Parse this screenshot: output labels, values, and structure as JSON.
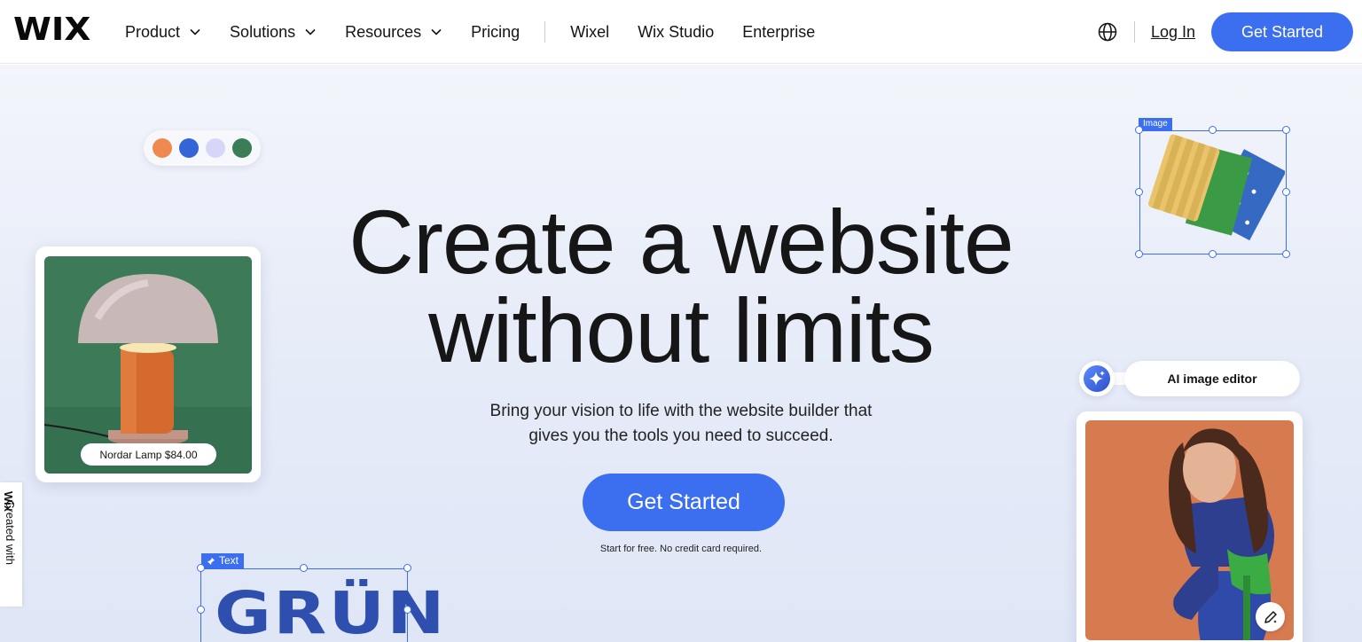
{
  "header": {
    "logo": "WIX",
    "nav": [
      {
        "label": "Product",
        "has_dropdown": true
      },
      {
        "label": "Solutions",
        "has_dropdown": true
      },
      {
        "label": "Resources",
        "has_dropdown": true
      },
      {
        "label": "Pricing",
        "has_dropdown": false
      },
      {
        "label": "Wixel",
        "has_dropdown": false
      },
      {
        "label": "Wix Studio",
        "has_dropdown": false
      },
      {
        "label": "Enterprise",
        "has_dropdown": false
      }
    ],
    "language_icon": "globe-icon",
    "login_label": "Log In",
    "cta_label": "Get Started"
  },
  "hero": {
    "headline_line1": "Create a website",
    "headline_line2": "without limits",
    "subline_line1": "Bring your vision to life with the website builder that",
    "subline_line2": "gives you the tools you need to succeed.",
    "cta_label": "Get Started",
    "note": "Start for free. No credit card required."
  },
  "decorations": {
    "swatch_colors": [
      "#ee8a4f",
      "#3464d6",
      "#d7d6f8",
      "#3b7d57"
    ],
    "lamp_price": "Nordar Lamp $84.00",
    "image_tag": "Image",
    "ai_editor_label": "AI image editor",
    "text_tag": "Text",
    "text_sample": "GRÜN"
  },
  "side_badge": {
    "prefix": "Created with",
    "brand": "Wix"
  },
  "colors": {
    "accent": "#3b6ff0",
    "text": "#141414"
  }
}
